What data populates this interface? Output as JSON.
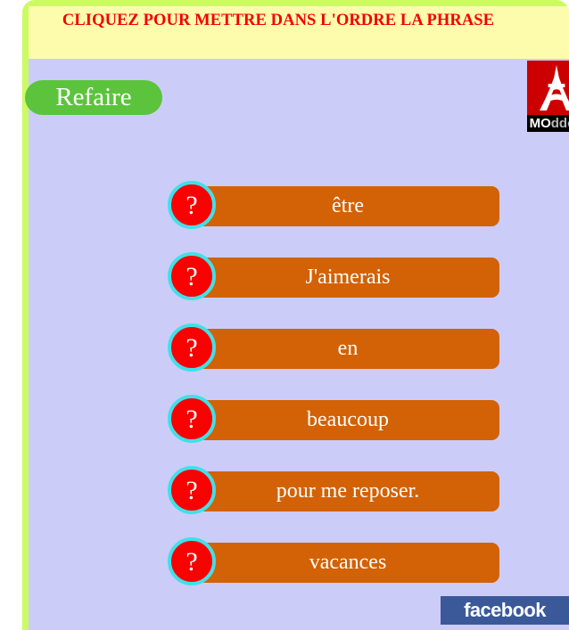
{
  "header": {
    "instruction": "CLIQUEZ POUR METTRE DANS L'ORDRE LA PHRASE"
  },
  "controls": {
    "refaire_label": "Refaire"
  },
  "logo": {
    "icon": "eiffel-tower-icon",
    "name_prefix": "MO",
    "name_suffix": "ddou"
  },
  "exercise": {
    "marker_symbol": "?",
    "words": [
      {
        "label": "être"
      },
      {
        "label": "J'aimerais"
      },
      {
        "label": "en"
      },
      {
        "label": "beaucoup"
      },
      {
        "label": "pour me reposer."
      },
      {
        "label": "vacances"
      }
    ]
  },
  "social": {
    "facebook_label": "facebook"
  },
  "colors": {
    "frame_green": "#ccfa62",
    "header_yellow": "#fdfcad",
    "body_lavender": "#ccccf9",
    "instruction_red": "#f40000",
    "word_bar_orange": "#d26205",
    "marker_red": "#fb0000",
    "marker_ring_cyan": "#40e0e8",
    "refaire_green": "#5cc43c",
    "facebook_blue": "#3b5998",
    "logo_red": "#cc0000"
  }
}
